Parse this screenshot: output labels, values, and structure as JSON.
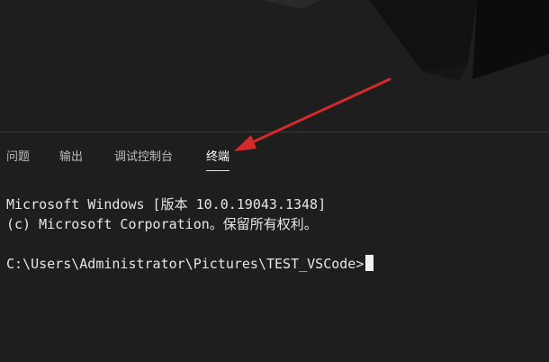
{
  "panel": {
    "tabs": [
      {
        "label": "问题"
      },
      {
        "label": "输出"
      },
      {
        "label": "调试控制台"
      },
      {
        "label": "终端",
        "active": true
      }
    ]
  },
  "terminal": {
    "lines": [
      "Microsoft Windows [版本 10.0.19043.1348]",
      "(c) Microsoft Corporation。保留所有权利。"
    ],
    "prompt": "C:\\Users\\Administrator\\Pictures\\TEST_VSCode>"
  },
  "colors": {
    "background": "#1e1e1e",
    "annotation_arrow": "#d42a2a",
    "active_tab_text": "#ffffff"
  },
  "icons": {
    "annotation": "red-arrow-icon",
    "background": "vscode-logo-icon"
  }
}
